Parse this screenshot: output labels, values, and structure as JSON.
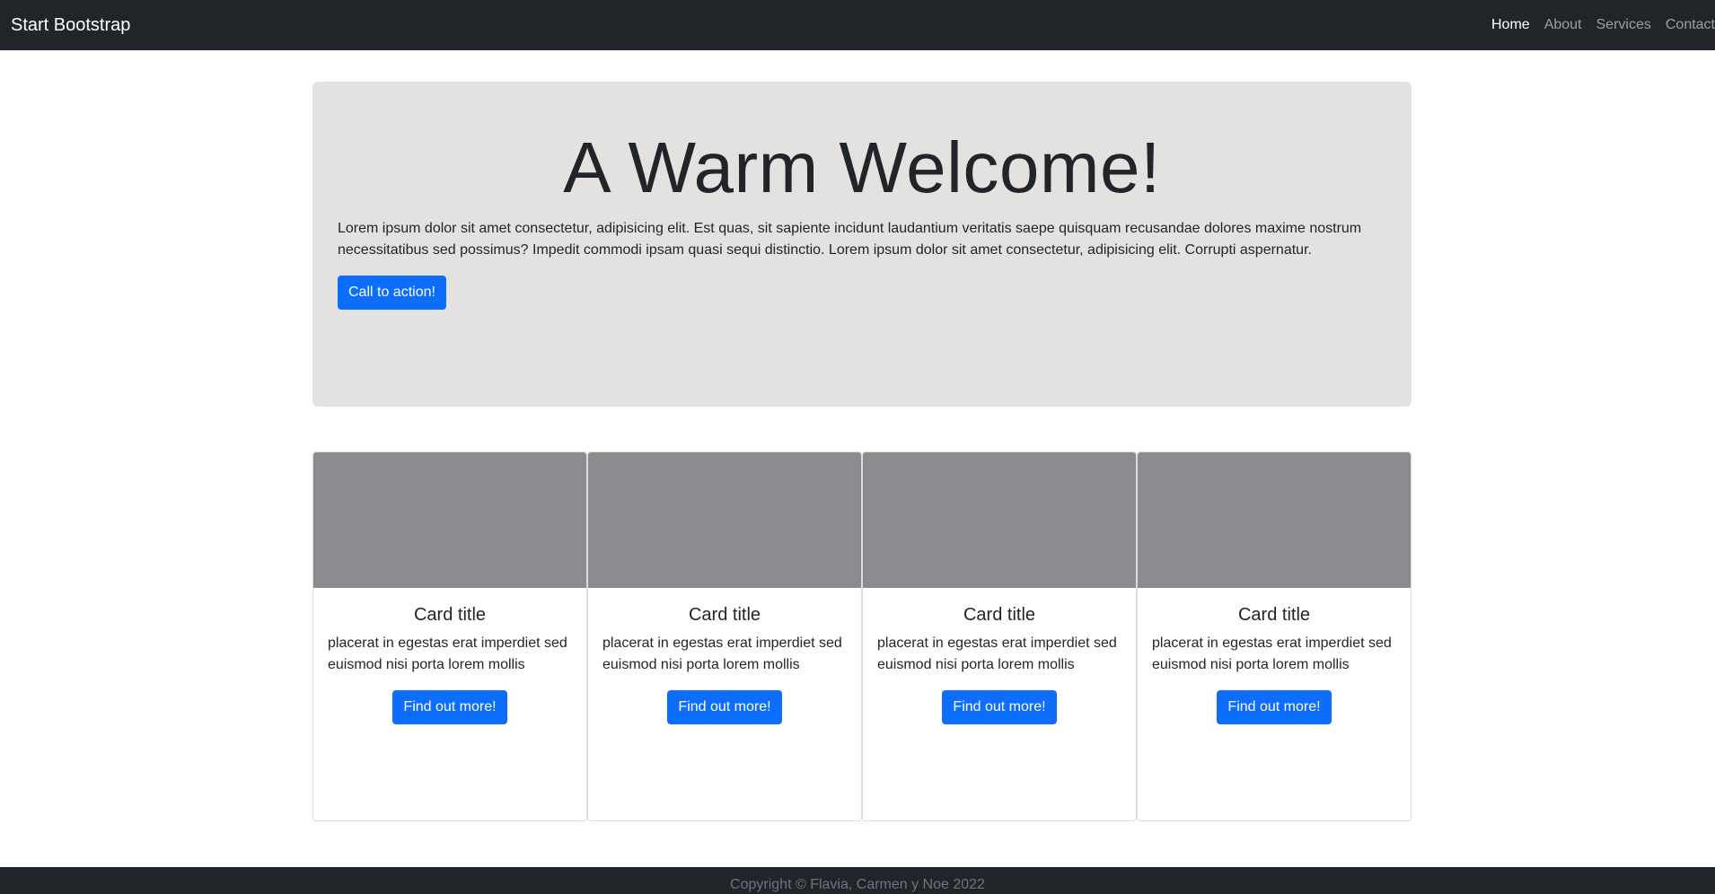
{
  "navbar": {
    "brand": "Start Bootstrap",
    "links": [
      {
        "label": "Home",
        "active": true
      },
      {
        "label": "About",
        "active": false
      },
      {
        "label": "Services",
        "active": false
      },
      {
        "label": "Contact",
        "active": false
      }
    ]
  },
  "hero": {
    "title": "A Warm Welcome!",
    "text": "Lorem ipsum dolor sit amet consectetur, adipisicing elit. Est quas, sit sapiente incidunt laudantium veritatis saepe quisquam recusandae dolores maxime nostrum necessitatibus sed possimus? Impedit commodi ipsam quasi sequi distinctio. Lorem ipsum dolor sit amet consectetur, adipisicing elit. Corrupti aspernatur.",
    "button_label": "Call to action!"
  },
  "cards": [
    {
      "title": "Card title",
      "text": "placerat in egestas erat imperdiet sed euismod nisi porta lorem mollis",
      "button_label": "Find out more!"
    },
    {
      "title": "Card title",
      "text": "placerat in egestas erat imperdiet sed euismod nisi porta lorem mollis",
      "button_label": "Find out more!"
    },
    {
      "title": "Card title",
      "text": "placerat in egestas erat imperdiet sed euismod nisi porta lorem mollis",
      "button_label": "Find out more!"
    },
    {
      "title": "Card title",
      "text": "placerat in egestas erat imperdiet sed euismod nisi porta lorem mollis",
      "button_label": "Find out more!"
    }
  ],
  "footer": {
    "copyright": "Copyright © Flavia, Carmen y Noe 2022"
  },
  "colors": {
    "navbar_bg": "#212529",
    "hero_bg": "#e3e2e1",
    "primary": "#0d6efd",
    "card_image_placeholder": "#8b8c90"
  }
}
